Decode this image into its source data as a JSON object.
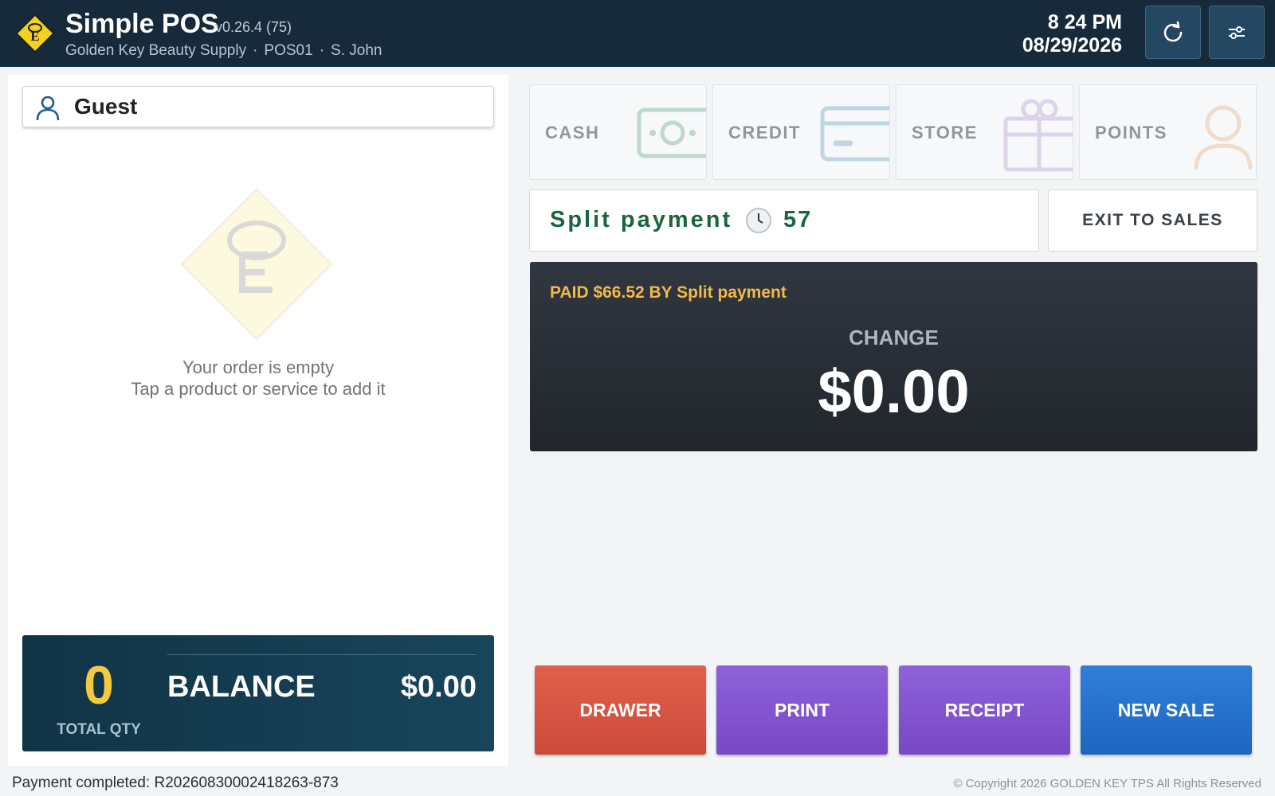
{
  "header": {
    "app_title": "Simple POS",
    "version": "v0.26.4 (75)",
    "store_name": "Golden Key Beauty Supply",
    "separator": "·",
    "register": "POS01",
    "cashier": "S. John",
    "time": "8 24 PM",
    "date": "08/29/2026",
    "refresh_icon": "refresh-icon",
    "settings_icon": "sliders-icon",
    "logo_letter": "E"
  },
  "order": {
    "customer_name": "Guest",
    "customer_icon": "person-icon",
    "empty_line1": "Your order is empty",
    "empty_line2": "Tap a product or service to add it"
  },
  "totals": {
    "total_qty": "0",
    "total_qty_label": "TOTAL QTY",
    "balance_label": "BALANCE",
    "balance_value": "$0.00"
  },
  "tenders": [
    {
      "label": "CASH",
      "icon": "cash-icon"
    },
    {
      "label": "CREDIT",
      "icon": "credit-card-icon"
    },
    {
      "label": "STORE",
      "icon": "gift-icon"
    },
    {
      "label": "POINTS",
      "icon": "person-icon"
    }
  ],
  "split": {
    "label": "Split payment",
    "clock_icon": "clock-icon",
    "countdown": "57"
  },
  "exit_button": "EXIT TO SALES",
  "change_panel": {
    "paid_text": "PAID $66.52 BY Split payment",
    "change_label": "CHANGE",
    "change_value": "$0.00"
  },
  "actions": {
    "drawer": "DRAWER",
    "print": "PRINT",
    "receipt": "RECEIPT",
    "new_sale": "NEW SALE"
  },
  "footer": {
    "status": "Payment completed: R20260830002418263-873",
    "copyright": "© Copyright 2026 GOLDEN KEY TPS All Rights Reserved"
  },
  "colors": {
    "header_bg": "#162a3c",
    "accent_green": "#17663f",
    "paid_gold": "#f2b94a",
    "qty_gold": "#f3c93f",
    "drawer_red": "#d5523f",
    "print_purple": "#8256cf",
    "new_sale_blue": "#2673cc"
  }
}
